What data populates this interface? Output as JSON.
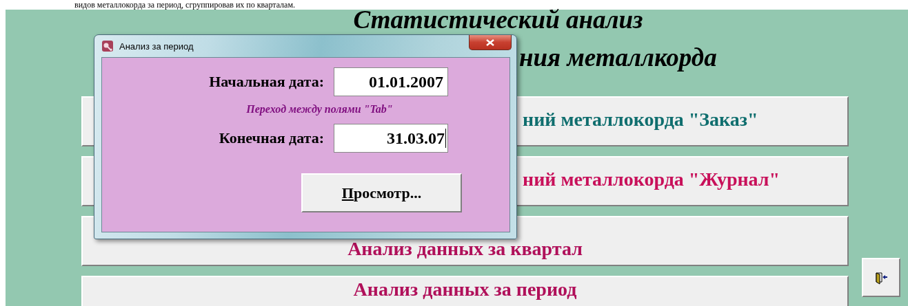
{
  "document_line": "видов металлокорда за период, сгруппировав их по кварталам.",
  "form": {
    "title_lines": [
      "Статистический анализ",
      "ния металлкорда"
    ],
    "buttons": [
      {
        "label": "ний металлокорда \"Заказ\"",
        "color": "#0f6e6e",
        "kind": "partial"
      },
      {
        "label": "ний металлокорда \"Журнал\"",
        "color": "#c8105a",
        "kind": "partial"
      },
      {
        "label": "Анализ данных за квартал",
        "color": "#b0105a",
        "kind": "full"
      },
      {
        "label": "Анализ данных за период",
        "color": "#b0105a",
        "kind": "full"
      }
    ]
  },
  "dialog": {
    "title": "Анализ за период",
    "start_label": "Начальная дата:",
    "start_value": "01.01.2007",
    "hint": "Переход между полями \"Tab\"",
    "end_label": "Конечная дата:",
    "end_value": "31.03.07",
    "button_accel": "П",
    "button_rest": "росмотр..."
  }
}
